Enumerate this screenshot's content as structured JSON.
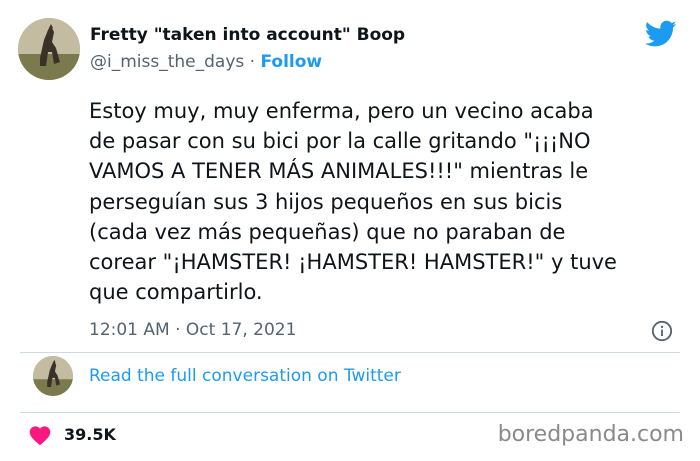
{
  "author": {
    "display_name": "Fretty \"taken into account\" Boop",
    "handle": "@i_miss_the_days",
    "separator": "·",
    "follow_label": "Follow"
  },
  "tweet": {
    "text_lines": [
      "Estoy muy, muy enferma, pero un vecino acaba",
      "de pasar con su bici por la calle gritando \"¡¡¡NO",
      "VAMOS A TENER MÁS ANIMALES!!!\" mientras le",
      "perseguían sus 3 hijos pequeños en sus bicis",
      "(cada vez más pequeñas) que no paraban de",
      "corear \"¡HAMSTER! ¡HAMSTER! HAMSTER!\" y tuve",
      "que compartirlo."
    ],
    "timestamp": "12:01 AM · Oct 17, 2021"
  },
  "conversation": {
    "link_label": "Read the full conversation on Twitter"
  },
  "engagement": {
    "likes": "39.5K"
  },
  "watermark": "boredpanda.com",
  "colors": {
    "twitter_blue": "#1d9bf0",
    "heart_red": "#f91880",
    "muted_text": "#536471",
    "divider": "#cfd9de"
  },
  "icons": [
    "twitter-bird-icon",
    "info-icon",
    "heart-icon"
  ]
}
